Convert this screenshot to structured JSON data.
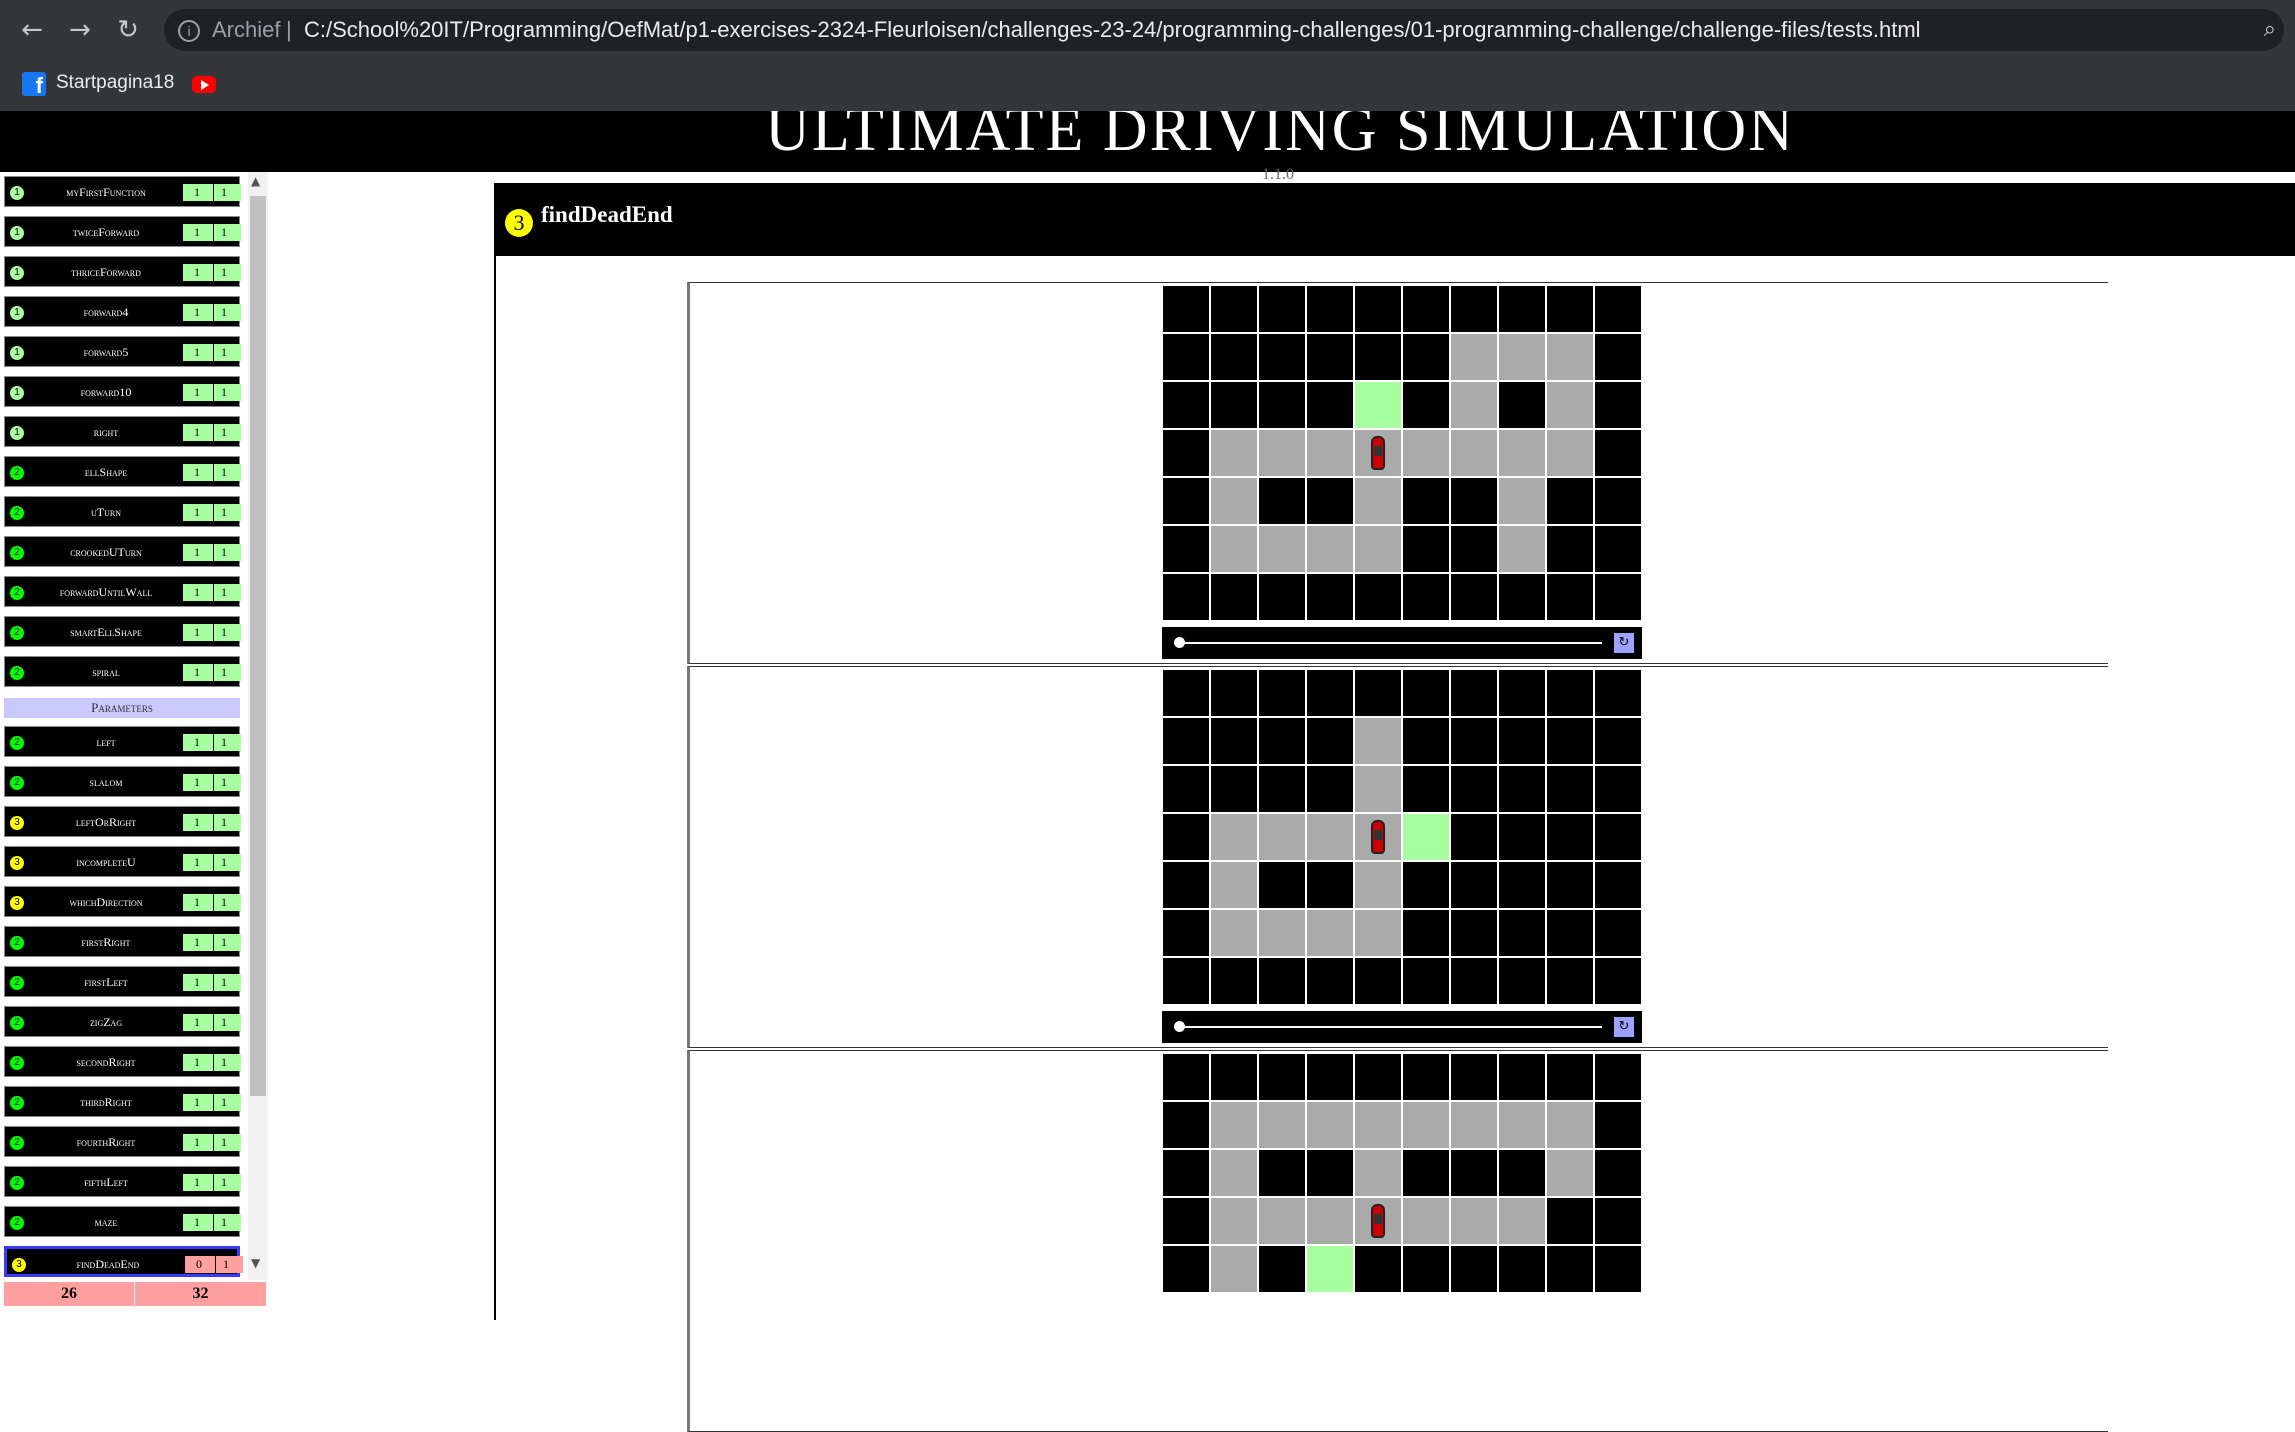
{
  "browser": {
    "back_icon": "arrow-left-icon",
    "forward_icon": "arrow-right-icon",
    "reload_icon": "reload-icon",
    "security_label": "Archief",
    "separator": "|",
    "url": "C:/School%20IT/Programming/OefMat/p1-exercises-2324-Fleurloisen/challenges-23-24/programming-challenges/01-programming-challenge/challenge-files/tests.html",
    "bookmark_label": "Startpagina18"
  },
  "page": {
    "title": "ULTIMATE DRIVING SIMULATION",
    "version": "1.1.0"
  },
  "sidebar": {
    "items": [
      {
        "name": "myFirstFunction",
        "level": "1",
        "score": "1",
        "max": "1"
      },
      {
        "name": "twiceForward",
        "level": "1",
        "score": "1",
        "max": "1"
      },
      {
        "name": "thriceForward",
        "level": "1",
        "score": "1",
        "max": "1"
      },
      {
        "name": "forward4",
        "level": "1",
        "score": "1",
        "max": "1"
      },
      {
        "name": "forward5",
        "level": "1",
        "score": "1",
        "max": "1"
      },
      {
        "name": "forward10",
        "level": "1",
        "score": "1",
        "max": "1"
      },
      {
        "name": "right",
        "level": "1",
        "score": "1",
        "max": "1"
      },
      {
        "name": "ellShape",
        "level": "2",
        "score": "1",
        "max": "1"
      },
      {
        "name": "uTurn",
        "level": "2",
        "score": "1",
        "max": "1"
      },
      {
        "name": "crookedUTurn",
        "level": "2",
        "score": "1",
        "max": "1"
      },
      {
        "name": "forwardUntilWall",
        "level": "2",
        "score": "1",
        "max": "1"
      },
      {
        "name": "smartEllShape",
        "level": "2",
        "score": "1",
        "max": "1"
      },
      {
        "name": "spiral",
        "level": "2",
        "score": "1",
        "max": "1"
      },
      {
        "section": "Parameters"
      },
      {
        "name": "left",
        "level": "2",
        "score": "1",
        "max": "1"
      },
      {
        "name": "slalom",
        "level": "2",
        "score": "1",
        "max": "1"
      },
      {
        "name": "leftOrRight",
        "level": "3",
        "score": "1",
        "max": "1"
      },
      {
        "name": "incompleteU",
        "level": "3",
        "score": "1",
        "max": "1"
      },
      {
        "name": "whichDirection",
        "level": "3",
        "score": "1",
        "max": "1"
      },
      {
        "name": "firstRight",
        "level": "2",
        "score": "1",
        "max": "1"
      },
      {
        "name": "firstLeft",
        "level": "2",
        "score": "1",
        "max": "1"
      },
      {
        "name": "zigZag",
        "level": "2",
        "score": "1",
        "max": "1"
      },
      {
        "name": "secondRight",
        "level": "2",
        "score": "1",
        "max": "1"
      },
      {
        "name": "thirdRight",
        "level": "2",
        "score": "1",
        "max": "1"
      },
      {
        "name": "fourthRight",
        "level": "2",
        "score": "1",
        "max": "1"
      },
      {
        "name": "fifthLeft",
        "level": "2",
        "score": "1",
        "max": "1"
      },
      {
        "name": "maze",
        "level": "2",
        "score": "1",
        "max": "1"
      },
      {
        "name": "findDeadEnd",
        "level": "3",
        "score": "0",
        "max": "1",
        "active": true
      }
    ],
    "totals": {
      "left": "26",
      "right": "32"
    }
  },
  "colors": {
    "level1": "#a8ff9f",
    "level2": "#00ff00",
    "level3": "#ffff00",
    "wall": "#000000",
    "road": "#aaaaaa",
    "goal": "#a8ff9f",
    "pass": "#a8ff9f",
    "fail": "#ff9f9f"
  },
  "challenge": {
    "level": "3",
    "name": "findDeadEnd",
    "legend": {
      "#": "wall",
      ".": "road",
      "G": "goal",
      "C": "car"
    },
    "cases": [
      {
        "grid": [
          "##########",
          "######...#",
          "####G#.#.#",
          "#...C....#",
          "#.##.##.##",
          "#....##.##",
          "##########"
        ],
        "reset_icon": "reset-icon"
      },
      {
        "grid": [
          "##########",
          "####.#####",
          "####.#####",
          "#...CG####",
          "#.##.#####",
          "#....#####",
          "##########"
        ],
        "reset_icon": "reset-icon"
      },
      {
        "grid": [
          "##########",
          "#........#",
          "#.##.###.#",
          "#...C...##",
          "#.#G######"
        ],
        "reset_icon": "reset-icon"
      }
    ]
  }
}
